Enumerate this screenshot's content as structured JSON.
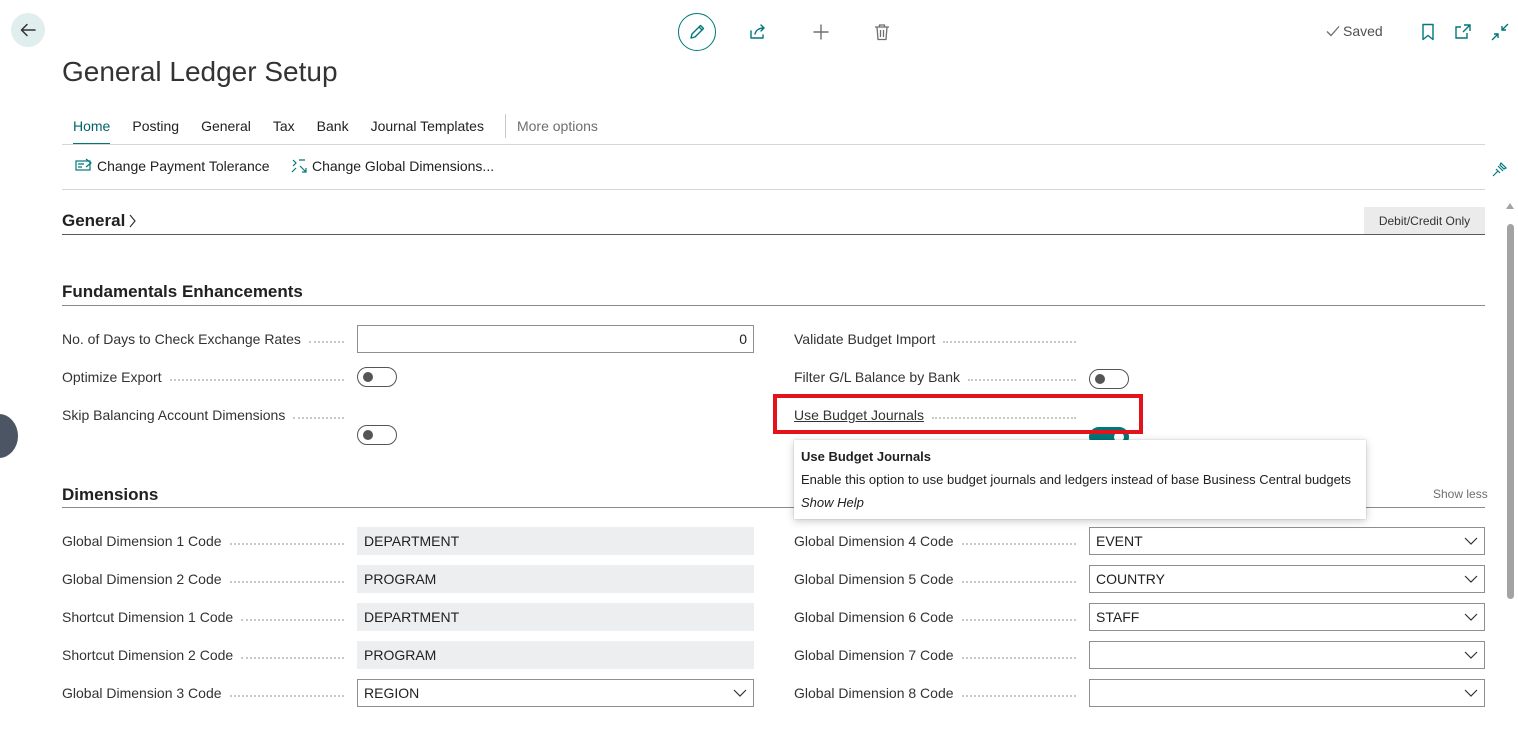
{
  "page": {
    "title": "General Ledger Setup",
    "saved_label": "Saved"
  },
  "tabs": [
    "Home",
    "Posting",
    "General",
    "Tax",
    "Bank",
    "Journal Templates"
  ],
  "more_options": "More options",
  "actions": {
    "change_payment_tolerance": "Change Payment Tolerance",
    "change_global_dimensions": "Change Global Dimensions..."
  },
  "general_section": {
    "title": "General",
    "badge": "Debit/Credit Only"
  },
  "fundamentals": {
    "title": "Fundamentals Enhancements",
    "left": [
      {
        "label": "No. of Days to Check Exchange Rates",
        "value": "0"
      },
      {
        "label": "Optimize Export",
        "toggle": false
      },
      {
        "label": "Skip Balancing Account Dimensions",
        "toggle": false
      }
    ],
    "right": [
      {
        "label": "Validate Budget Import",
        "toggle": false
      },
      {
        "label": "Filter G/L Balance by Bank",
        "toggle": true
      },
      {
        "label": "Use Budget Journals",
        "toggle": true
      }
    ]
  },
  "tooltip": {
    "title": "Use Budget Journals",
    "description": "Enable this option to use budget journals and ledgers instead of base Business Central budgets",
    "show_help": "Show Help"
  },
  "dimensions": {
    "title": "Dimensions",
    "show_less": "Show less",
    "left": [
      {
        "label": "Global Dimension 1 Code",
        "value": "DEPARTMENT"
      },
      {
        "label": "Global Dimension 2 Code",
        "value": "PROGRAM"
      },
      {
        "label": "Shortcut Dimension 1 Code",
        "value": "DEPARTMENT"
      },
      {
        "label": "Shortcut Dimension 2 Code",
        "value": "PROGRAM"
      },
      {
        "label": "Global Dimension 3 Code",
        "value": "REGION"
      }
    ],
    "right": [
      {
        "label": "Global Dimension 4 Code",
        "value": "EVENT"
      },
      {
        "label": "Global Dimension 5 Code",
        "value": "COUNTRY"
      },
      {
        "label": "Global Dimension 6 Code",
        "value": "STAFF"
      },
      {
        "label": "Global Dimension 7 Code",
        "value": ""
      },
      {
        "label": "Global Dimension 8 Code",
        "value": ""
      }
    ]
  },
  "colors": {
    "accent": "#00777a",
    "highlight": "#e3121b"
  }
}
